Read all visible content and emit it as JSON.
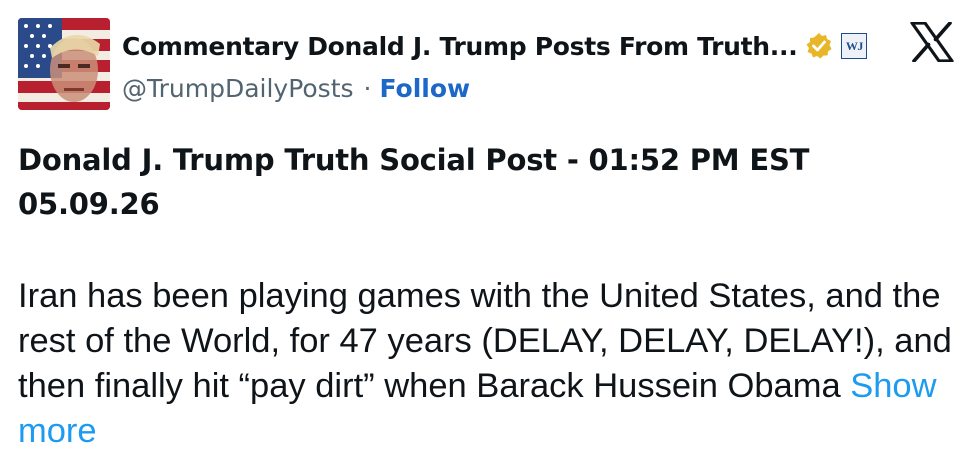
{
  "header": {
    "display_name": "Commentary Donald J. Trump Posts From Truth...",
    "handle": "@TrumpDailyPosts",
    "separator": "·",
    "follow_label": "Follow",
    "affiliate_badge_text": "WJ",
    "verified": true,
    "platform_logo": "x-logo-icon"
  },
  "post": {
    "title": "Donald J. Trump Truth Social Post - 01:52 PM EST 05.09.26",
    "body": "Iran has been playing games with the United States, and the rest of the World, for 47 years (DELAY, DELAY, DELAY!), and then finally hit “pay dirt” when Barack Hussein Obama",
    "show_more_label": "Show more"
  },
  "colors": {
    "link": "#1d67c9",
    "show_more": "#1d9bf0",
    "handle": "#536471",
    "verified_badge": "#e8b629"
  }
}
